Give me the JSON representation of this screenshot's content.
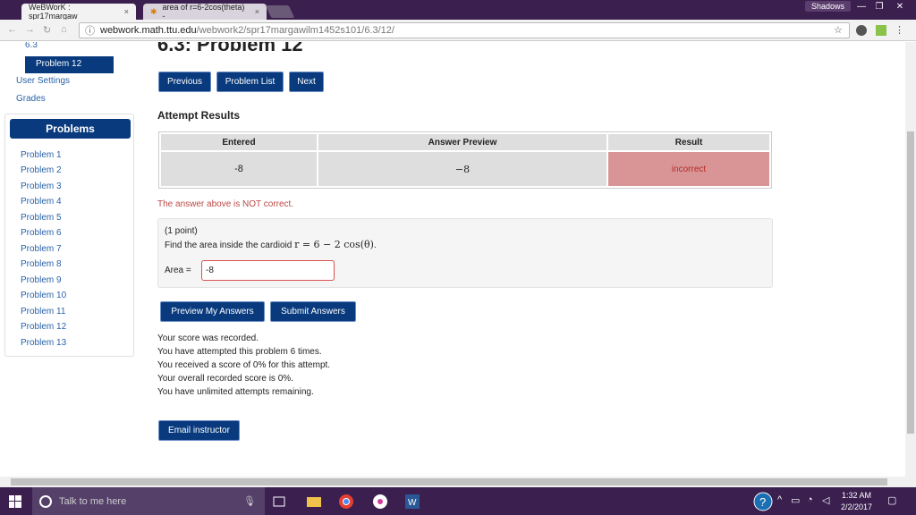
{
  "browser": {
    "tabs": [
      {
        "title": "WeBWorK : spr17margaw",
        "close": "×"
      },
      {
        "title": "area of r=6-2cos(theta) -",
        "close": "×"
      }
    ],
    "profile": "Shadows",
    "window_controls": [
      "—",
      "❐",
      "✕"
    ],
    "url_host": "webwork.math.ttu.edu",
    "url_path": "/webwork2/spr17margawilm1452s101/6.3/12/",
    "colors": {
      "tab_bar": "#3b1f4f",
      "toolbar": "#f2f2f2"
    }
  },
  "sidebar": {
    "section_link": "6.3",
    "active_problem": "Problem 12",
    "links": [
      "User Settings",
      "Grades"
    ],
    "problems_heading": "Problems",
    "problems": [
      "Problem 1",
      "Problem 2",
      "Problem 3",
      "Problem 4",
      "Problem 5",
      "Problem 6",
      "Problem 7",
      "Problem 8",
      "Problem 9",
      "Problem 10",
      "Problem 11",
      "Problem 12",
      "Problem 13"
    ]
  },
  "main": {
    "title": "6.3: Problem 12",
    "nav": {
      "previous": "Previous",
      "problem_list": "Problem List",
      "next": "Next"
    },
    "attempt_heading": "Attempt Results",
    "results_table": {
      "headers": [
        "Entered",
        "Answer Preview",
        "Result"
      ],
      "rows": [
        [
          "-8",
          "−8",
          "incorrect"
        ]
      ]
    },
    "not_correct_msg": "The answer above is NOT correct.",
    "problem": {
      "points": "(1 point)",
      "question": "Find the area inside the cardioid",
      "math": "r = 6 − 2 cos(θ)",
      "period": ".",
      "answer_label": "Area =",
      "answer_value": "-8"
    },
    "buttons": {
      "preview": "Preview My Answers",
      "submit": "Submit Answers",
      "email": "Email instructor"
    },
    "messages": [
      "Your score was recorded.",
      "You have attempted this problem 6 times.",
      "You received a score of 0% for this attempt.",
      "Your overall recorded score is 0%.",
      "You have unlimited attempts remaining."
    ],
    "colors": {
      "button": "#083a7d",
      "incorrect_bg": "#d99595",
      "error_text": "#b94a48"
    }
  },
  "taskbar": {
    "search_placeholder": "Talk to me here",
    "time": "1:32 AM",
    "date": "2/2/2017",
    "icons": [
      "windows-icon",
      "mic-icon",
      "task-view-icon",
      "file-explorer-icon",
      "chrome-icon",
      "itunes-icon",
      "word-icon",
      "help-icon",
      "chevron-up-icon",
      "network-icon",
      "wifi-icon",
      "volume-icon",
      "notification-icon"
    ],
    "colors": {
      "taskbar": "#3a1f4f"
    }
  }
}
